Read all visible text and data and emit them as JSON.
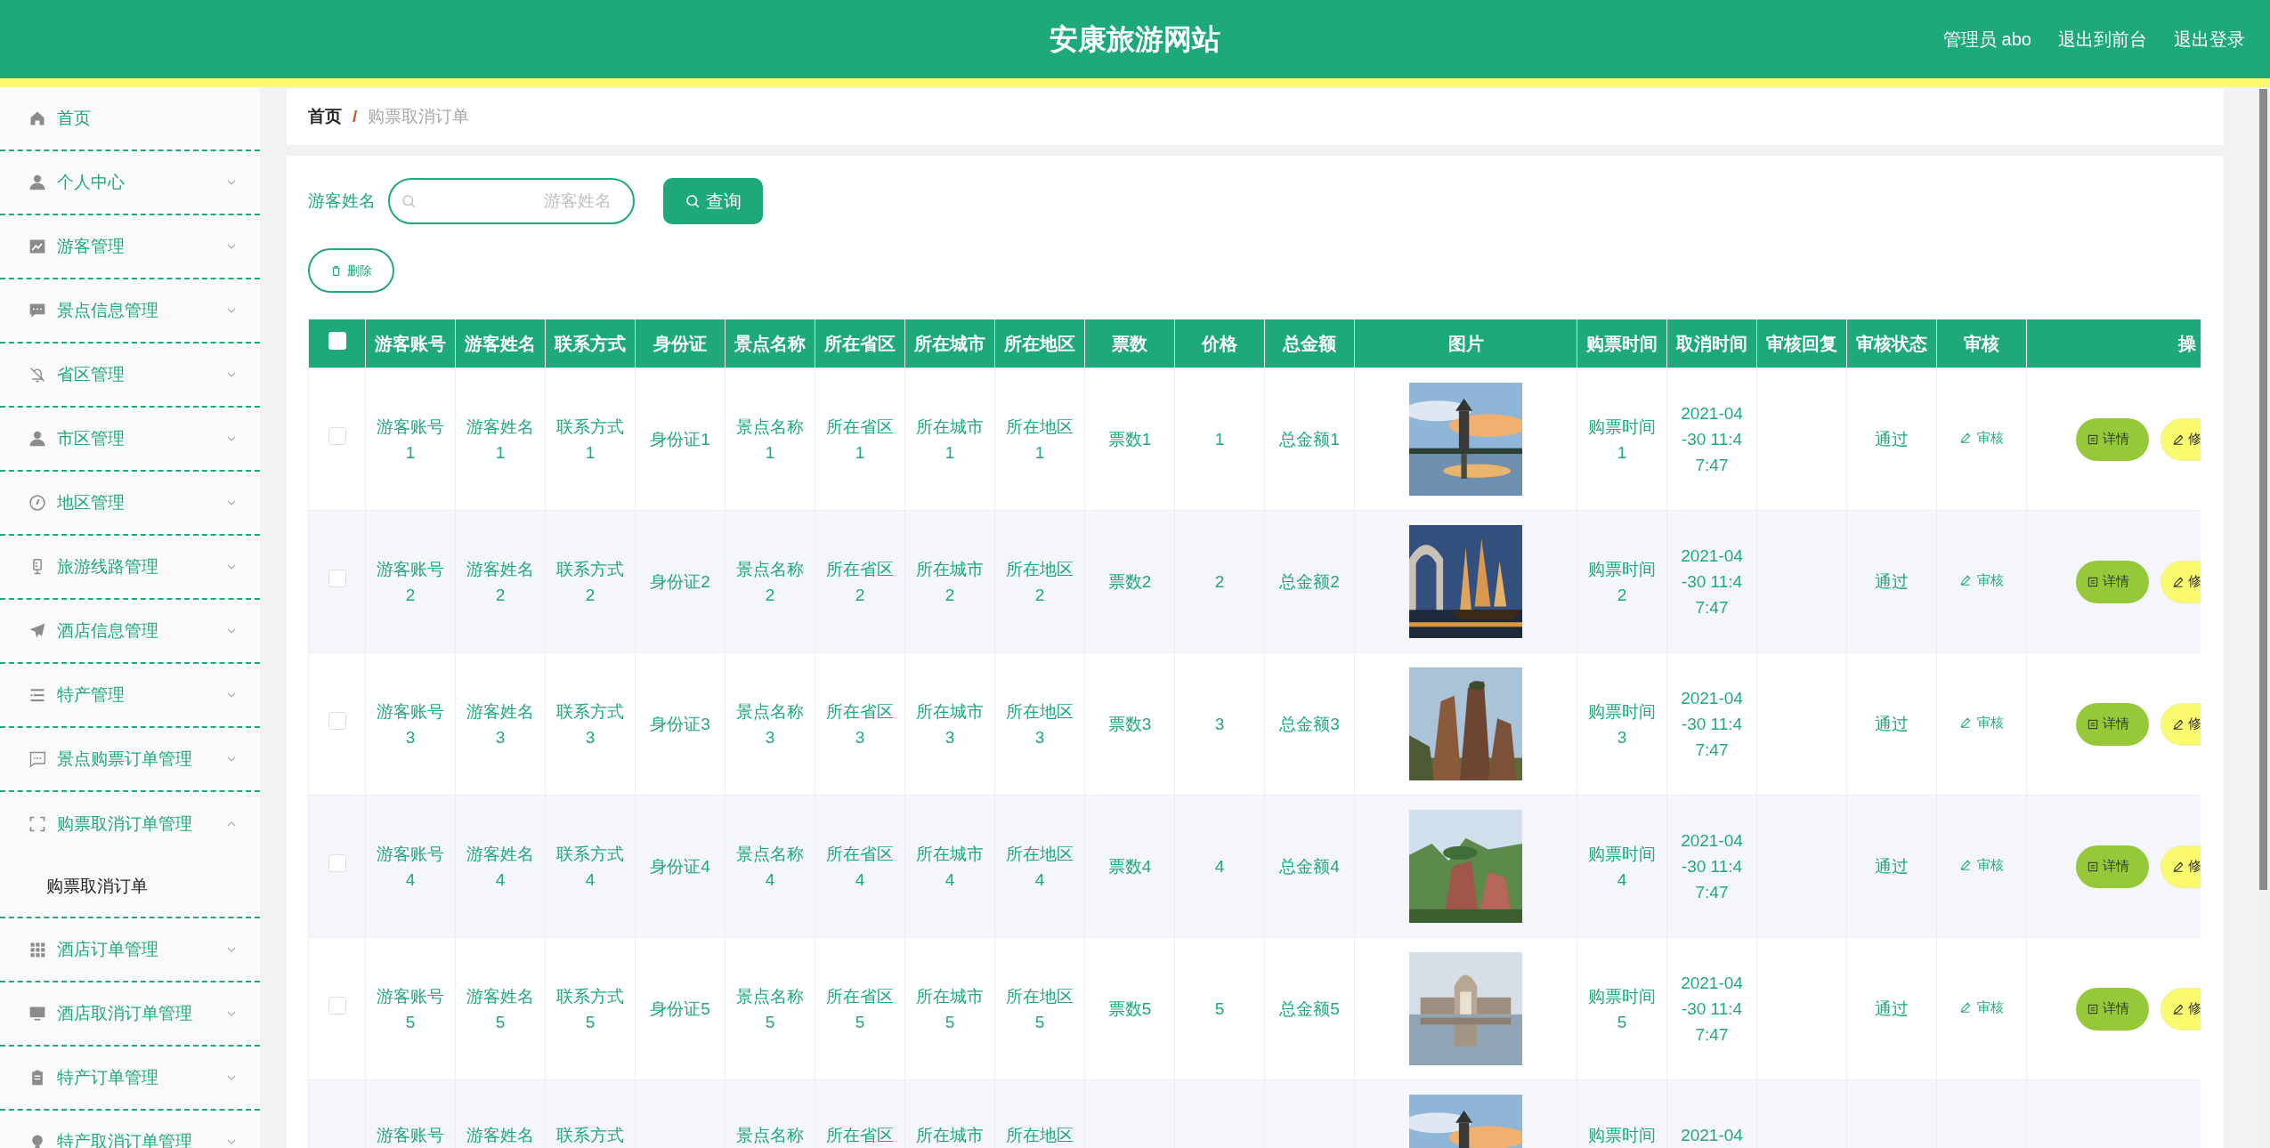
{
  "header": {
    "title": "安康旅游网站",
    "links": [
      "管理员 abo",
      "退出到前台",
      "退出登录"
    ]
  },
  "sidebar": {
    "items": [
      {
        "kind": "link",
        "label": "首页"
      },
      {
        "kind": "menu",
        "label": "个人中心",
        "expanded": false
      },
      {
        "kind": "menu",
        "label": "游客管理",
        "expanded": false
      },
      {
        "kind": "menu",
        "label": "景点信息管理",
        "expanded": false
      },
      {
        "kind": "menu",
        "label": "省区管理",
        "expanded": false
      },
      {
        "kind": "menu",
        "label": "市区管理",
        "expanded": false
      },
      {
        "kind": "menu",
        "label": "地区管理",
        "expanded": false
      },
      {
        "kind": "menu",
        "label": "旅游线路管理",
        "expanded": false
      },
      {
        "kind": "menu",
        "label": "酒店信息管理",
        "expanded": false
      },
      {
        "kind": "menu",
        "label": "特产管理",
        "expanded": false
      },
      {
        "kind": "menu",
        "label": "景点购票订单管理",
        "expanded": false
      },
      {
        "kind": "menu",
        "label": "购票取消订单管理",
        "expanded": true,
        "children": [
          {
            "label": "购票取消订单"
          }
        ]
      },
      {
        "kind": "menu",
        "label": "酒店订单管理",
        "expanded": false
      },
      {
        "kind": "menu",
        "label": "酒店取消订单管理",
        "expanded": false
      },
      {
        "kind": "menu",
        "label": "特产订单管理",
        "expanded": false
      },
      {
        "kind": "menu",
        "label": "特产取消订单管理",
        "expanded": false
      }
    ]
  },
  "breadcrumb": {
    "items": [
      "首页",
      "购票取消订单"
    ],
    "separator": "/"
  },
  "search": {
    "label": "游客姓名",
    "placeholder": "游客姓名",
    "button": "查询"
  },
  "delete_button": "删除",
  "table": {
    "select_all": {
      "checked": false
    },
    "columns": [
      "游客账号",
      "游客姓名",
      "联系方式",
      "身份证",
      "景点名称",
      "所在省区",
      "所在城市",
      "所在地区",
      "票数",
      "价格",
      "总金额",
      "图片",
      "购票时间",
      "取消时间",
      "审核回复",
      "审核状态",
      "审核",
      "操"
    ],
    "rows": [
      {
        "checked": false,
        "cells": [
          "游客账号1",
          "游客姓名1",
          "联系方式1",
          "身份证1",
          "景点名称1",
          "所在省区1",
          "所在城市1",
          "所在地区1",
          "票数1",
          "1",
          "总金额1"
        ],
        "purchase_time": "购票时间1",
        "cancel_time": "2021-04-30 11:47:47",
        "status": "通过",
        "review": "审核",
        "buttons": [
          {
            "kind": "detail",
            "label": "详情"
          },
          {
            "kind": "edit",
            "label": "修"
          }
        ]
      },
      {
        "checked": false,
        "cells": [
          "游客账号2",
          "游客姓名2",
          "联系方式2",
          "身份证2",
          "景点名称2",
          "所在省区2",
          "所在城市2",
          "所在地区2",
          "票数2",
          "2",
          "总金额2"
        ],
        "purchase_time": "购票时间2",
        "cancel_time": "2021-04-30 11:47:47",
        "status": "通过",
        "review": "审核",
        "buttons": [
          {
            "kind": "detail",
            "label": "详情"
          },
          {
            "kind": "edit",
            "label": "修"
          }
        ]
      },
      {
        "checked": false,
        "cells": [
          "游客账号3",
          "游客姓名3",
          "联系方式3",
          "身份证3",
          "景点名称3",
          "所在省区3",
          "所在城市3",
          "所在地区3",
          "票数3",
          "3",
          "总金额3"
        ],
        "purchase_time": "购票时间3",
        "cancel_time": "2021-04-30 11:47:47",
        "status": "通过",
        "review": "审核",
        "buttons": [
          {
            "kind": "detail",
            "label": "详情"
          },
          {
            "kind": "edit",
            "label": "修"
          }
        ]
      },
      {
        "checked": false,
        "cells": [
          "游客账号4",
          "游客姓名4",
          "联系方式4",
          "身份证4",
          "景点名称4",
          "所在省区4",
          "所在城市4",
          "所在地区4",
          "票数4",
          "4",
          "总金额4"
        ],
        "purchase_time": "购票时间4",
        "cancel_time": "2021-04-30 11:47:47",
        "status": "通过",
        "review": "审核",
        "buttons": [
          {
            "kind": "detail",
            "label": "详情"
          },
          {
            "kind": "edit",
            "label": "修"
          }
        ]
      },
      {
        "checked": false,
        "cells": [
          "游客账号5",
          "游客姓名5",
          "联系方式5",
          "身份证5",
          "景点名称5",
          "所在省区5",
          "所在城市5",
          "所在地区5",
          "票数5",
          "5",
          "总金额5"
        ],
        "purchase_time": "购票时间5",
        "cancel_time": "2021-04-30 11:47:47",
        "status": "通过",
        "review": "审核",
        "buttons": [
          {
            "kind": "detail",
            "label": "详情"
          },
          {
            "kind": "edit",
            "label": "修"
          }
        ]
      },
      {
        "cells": [
          "游客账号",
          "游客姓名",
          "联系方式",
          null,
          "景点名称",
          "所在省区",
          "所在城市",
          "所在地区",
          null,
          null,
          null
        ],
        "purchase_time": "购票时间",
        "cancel_time": "2021-04"
      }
    ]
  }
}
